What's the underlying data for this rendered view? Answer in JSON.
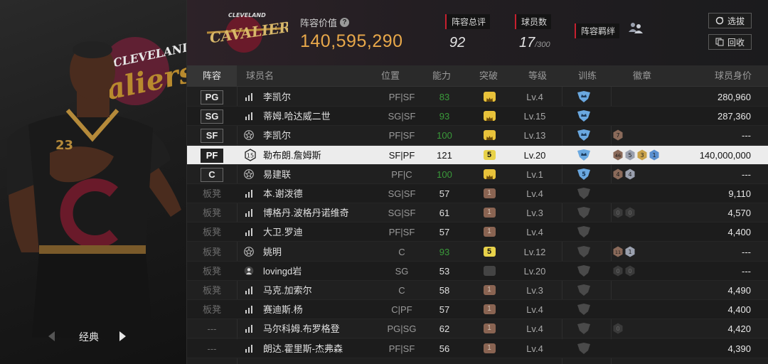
{
  "player_panel": {
    "mode_label": "经典",
    "jersey_number": "23"
  },
  "header": {
    "team_logo_text": "CLEVELAND CAVALIERS",
    "lineup_value_label": "阵容价值",
    "lineup_value": "140,595,290",
    "overall_label": "阵容总评",
    "overall_value": "92",
    "players_label": "球员数",
    "players_count": "17",
    "players_max": "/300",
    "chemistry_label": "阵容羁绊",
    "select_btn": "选拔",
    "recycle_btn": "回收"
  },
  "table": {
    "columns": [
      "阵容",
      "球员名",
      "位置",
      "能力",
      "突破",
      "等级",
      "训练",
      "徽章",
      "球员身价"
    ],
    "rows": [
      {
        "slot": "PG",
        "icon": "bars-icon",
        "name": "李凯尔",
        "position": "PF|SF",
        "ovr": "83",
        "ovr_green": true,
        "break": "gold",
        "level": "Lv.4",
        "train": "blue",
        "badges": [],
        "value": "280,960"
      },
      {
        "slot": "SG",
        "icon": "bars-icon",
        "name": "蒂姆.哈达威二世",
        "position": "SG|SF",
        "ovr": "93",
        "ovr_green": true,
        "break": "gold",
        "level": "Lv.15",
        "train": "blue",
        "badges": [],
        "value": "287,360"
      },
      {
        "slot": "SF",
        "icon": "star-icon",
        "name": "李凯尔",
        "position": "PF|SF",
        "ovr": "100",
        "ovr_green": true,
        "break": "gold",
        "level": "Lv.13",
        "train": "blue",
        "badges": [
          {
            "c": "#8a6a5a",
            "t": "7"
          }
        ],
        "value": "---"
      },
      {
        "slot": "PF",
        "icon": "number-icon",
        "name": "勒布朗.詹姆斯",
        "position": "SF|PF",
        "ovr": "121",
        "ovr_green": false,
        "break": "gold5",
        "level": "Lv.20",
        "train": "blue",
        "badges": [
          {
            "c": "#8a6a5a",
            "t": "46"
          },
          {
            "c": "#9aa0ae",
            "t": "5"
          },
          {
            "c": "#c9a24a",
            "t": "3"
          },
          {
            "c": "#5a8fcf",
            "t": "1"
          }
        ],
        "value": "140,000,000",
        "selected": true
      },
      {
        "slot": "C",
        "icon": "star-icon",
        "name": "易建联",
        "position": "PF|C",
        "ovr": "100",
        "ovr_green": true,
        "break": "gold",
        "level": "Lv.1",
        "train": "blue5",
        "badges": [
          {
            "c": "#8a6a5a",
            "t": "4"
          },
          {
            "c": "#9aa0ae",
            "t": "4"
          }
        ],
        "value": "---"
      },
      {
        "slot": "板凳",
        "icon": "bars-icon",
        "name": "本.谢泼德",
        "position": "SG|SF",
        "ovr": "57",
        "ovr_green": false,
        "break": "brown",
        "level": "Lv.4",
        "train": "grey",
        "badges": [],
        "value": "9,110"
      },
      {
        "slot": "板凳",
        "icon": "bars-icon",
        "name": "博格丹.波格丹诺维奇",
        "position": "SG|SF",
        "ovr": "61",
        "ovr_green": false,
        "break": "brown",
        "level": "Lv.3",
        "train": "grey",
        "badges": [
          {
            "c": "#3a3a3a",
            "t": "0"
          },
          {
            "c": "#3a3a3a",
            "t": "0"
          }
        ],
        "value": "4,570"
      },
      {
        "slot": "板凳",
        "icon": "bars-icon",
        "name": "大卫.罗迪",
        "position": "PF|SF",
        "ovr": "57",
        "ovr_green": false,
        "break": "brown",
        "level": "Lv.4",
        "train": "grey",
        "badges": [],
        "value": "4,400"
      },
      {
        "slot": "板凳",
        "icon": "star-icon",
        "name": "姚明",
        "position": "C",
        "ovr": "93",
        "ovr_green": true,
        "break": "gold5",
        "level": "Lv.12",
        "train": "grey",
        "badges": [
          {
            "c": "#8a6a5a",
            "t": "11"
          },
          {
            "c": "#9aa0ae",
            "t": "1"
          }
        ],
        "value": "---"
      },
      {
        "slot": "板凳",
        "icon": "person-icon",
        "name": "lovingd岩",
        "position": "SG",
        "ovr": "53",
        "ovr_green": false,
        "break": "grey",
        "level": "Lv.20",
        "train": "grey",
        "badges": [
          {
            "c": "#3a3a3a",
            "t": "0"
          },
          {
            "c": "#3a3a3a",
            "t": "0"
          }
        ],
        "value": "---"
      },
      {
        "slot": "板凳",
        "icon": "bars-icon",
        "name": "马克.加索尔",
        "position": "C",
        "ovr": "58",
        "ovr_green": false,
        "break": "brown",
        "level": "Lv.3",
        "train": "grey",
        "badges": [],
        "value": "4,490"
      },
      {
        "slot": "板凳",
        "icon": "bars-icon",
        "name": "赛迪斯.杨",
        "position": "C|PF",
        "ovr": "57",
        "ovr_green": false,
        "break": "brown",
        "level": "Lv.4",
        "train": "grey",
        "badges": [],
        "value": "4,400"
      },
      {
        "slot": "---",
        "icon": "bars-icon",
        "name": "马尔科姆.布罗格登",
        "position": "PG|SG",
        "ovr": "62",
        "ovr_green": false,
        "break": "brown",
        "level": "Lv.4",
        "train": "grey",
        "badges": [
          {
            "c": "#3a3a3a",
            "t": "0"
          }
        ],
        "value": "4,420"
      },
      {
        "slot": "---",
        "icon": "bars-icon",
        "name": "朗达.霍里斯-杰弗森",
        "position": "PF|SF",
        "ovr": "56",
        "ovr_green": false,
        "break": "brown",
        "level": "Lv.4",
        "train": "grey",
        "badges": [],
        "value": "4,390"
      }
    ]
  },
  "colors": {
    "accent_gold": "#e8a84a",
    "stat_red": "#c7202f",
    "ovr_green": "#3a9a3a"
  }
}
